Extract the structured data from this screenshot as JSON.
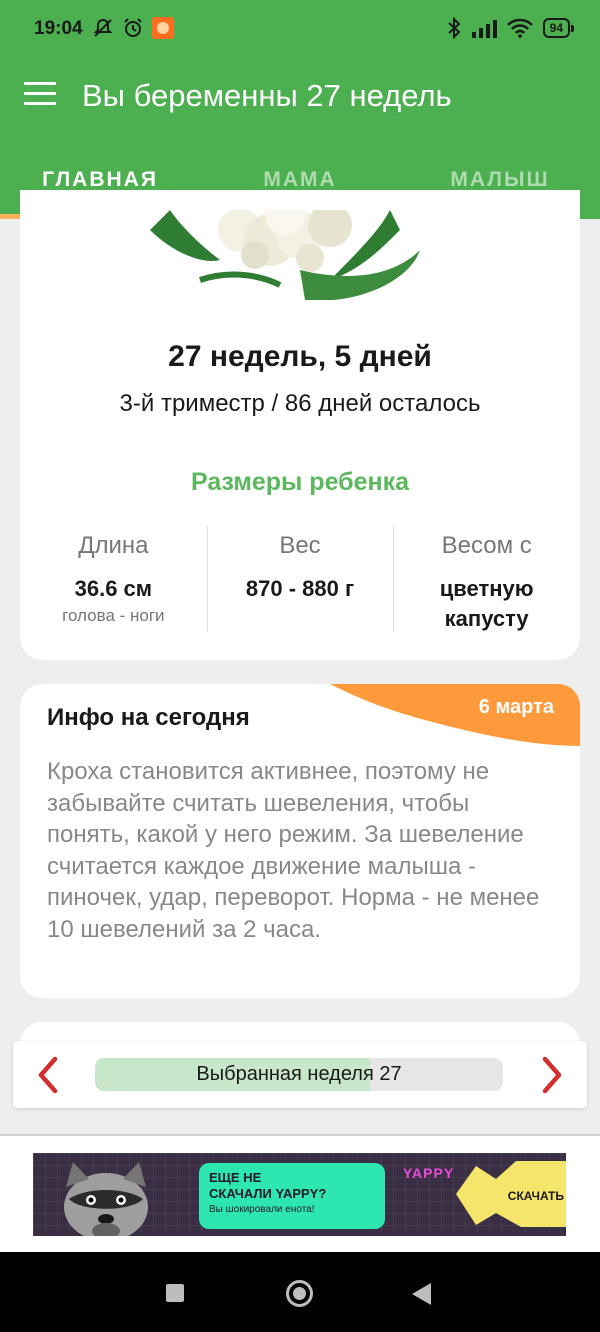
{
  "status_bar": {
    "time": "19:04",
    "battery": "94",
    "icons_left": [
      "notifications-off-icon",
      "alarm-icon",
      "app-notification-icon"
    ],
    "icons_right": [
      "bluetooth-icon",
      "signal-icon",
      "wifi-icon",
      "battery-icon"
    ]
  },
  "app_bar": {
    "title": "Вы беременны 27 недель",
    "menu_icon": "hamburger-menu-icon"
  },
  "tabs": [
    {
      "label": "ГЛАВНАЯ",
      "active": true
    },
    {
      "label": "МАМА",
      "active": false
    },
    {
      "label": "МАЛЫШ",
      "active": false
    }
  ],
  "week_card": {
    "image": "cauliflower-image",
    "title": "27 недель, 5 дней",
    "subtitle": "3-й триместр / 86 дней осталось",
    "sizes_title": "Размеры ребенка",
    "columns": [
      {
        "head": "Длина",
        "value": "36.6 см",
        "note": "голова - ноги"
      },
      {
        "head": "Вес",
        "value": "870 - 880 г",
        "note": ""
      },
      {
        "head": "Весом с",
        "value": "цветную капусту",
        "note": ""
      }
    ]
  },
  "info_card": {
    "title": "Инфо на сегодня",
    "date": "6 марта",
    "text": "Кроха становится активнее, поэтому не забывайте считать шевеления, чтобы понять, какой у него режим. За шевеление считается каждое движение малыша - пиночек, удар, переворот. Норма - не менее 10 шевелений за 2 часа."
  },
  "week_selector": {
    "label": "Выбранная неделя 27",
    "progress": 0.675,
    "prev_icon": "chevron-left-icon",
    "next_icon": "chevron-right-icon"
  },
  "ad": {
    "headline_1": "ЕЩЕ НЕ",
    "headline_2": "СКАЧАЛИ YAPPY?",
    "sub": "Вы шокировали енота!",
    "brand": "YAPPY",
    "cta": "СКАЧАТЬ"
  },
  "colors": {
    "primary": "#4caf50",
    "accent_orange": "#ff9a3c",
    "tab_indicator": "#ffb05a",
    "sizes_title": "#5cb85c",
    "arrow_red": "#d32f2f"
  }
}
